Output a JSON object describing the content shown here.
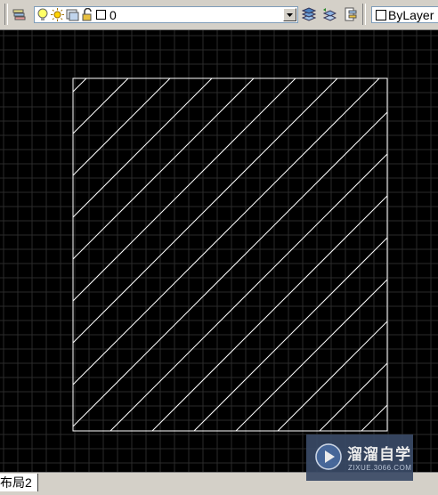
{
  "toolbar": {
    "layer_name": "0",
    "color_value": "ByLayer",
    "icons": [
      "layer-manager-icon",
      "bulb-icon",
      "sun-icon",
      "freeze-viewport-icon",
      "lock-icon",
      "layer-color-swatch-icon",
      "make-current-icon",
      "layer-previous-icon",
      "layer-states-icon"
    ]
  },
  "layout_tab": {
    "label": "布局2"
  },
  "watermark": {
    "brand": "溜溜自学",
    "url": "ZIXUE.3066.COM"
  },
  "colors": {
    "canvas": "#000000",
    "grid": "#2a2a2a",
    "geometry": "#ffffff",
    "toolbar": "#d4d0c8"
  }
}
